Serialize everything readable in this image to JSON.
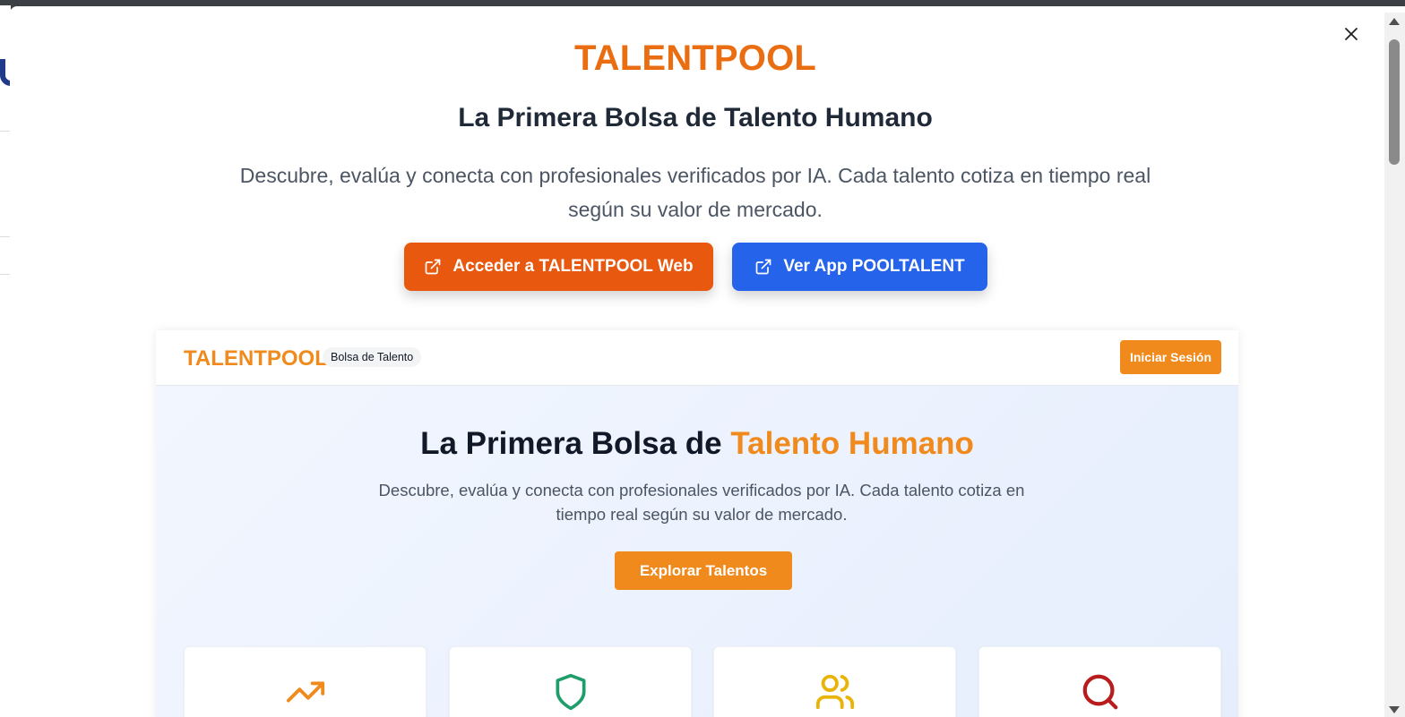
{
  "modal": {
    "brand": "TALENTPOOL",
    "headline": "La Primera Bolsa de Talento Humano",
    "subtext": "Descubre, evalúa y conecta con profesionales verificados por IA. Cada talento cotiza en tiempo real según su valor de mercado.",
    "buttons": {
      "web_label": "Acceder a TALENTPOOL Web",
      "app_label": "Ver App POOLTALENT"
    },
    "close_icon": "close-icon",
    "colors": {
      "brand": "#ea6d12",
      "web_button": "#e8580f",
      "app_button": "#2563eb"
    }
  },
  "preview": {
    "header": {
      "brand": "TALENTPOOL",
      "badge": "Bolsa de Talento",
      "login_label": "Iniciar Sesión"
    },
    "hero": {
      "title_prefix": "La Primera Bolsa de ",
      "title_accent": "Talento Humano",
      "subtitle": "Descubre, evalúa y conecta con profesionales verificados por IA. Cada talento cotiza en tiempo real según su valor de mercado.",
      "explore_label": "Explorar Talentos"
    },
    "feature_cards": [
      {
        "icon": "trending-up-icon",
        "color": "#f08a1c"
      },
      {
        "icon": "shield-icon",
        "color": "#1f9d6b"
      },
      {
        "icon": "users-icon",
        "color": "#eab308"
      },
      {
        "icon": "search-icon",
        "color": "#b91c1c"
      }
    ],
    "colors": {
      "accent": "#f08a1c"
    }
  }
}
